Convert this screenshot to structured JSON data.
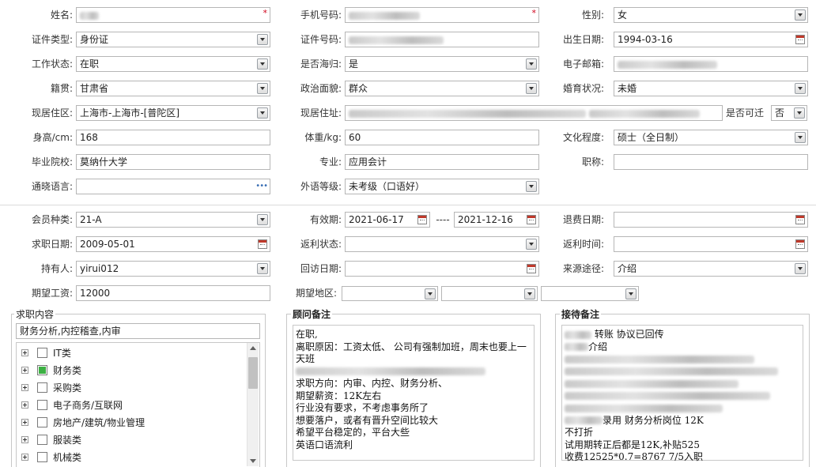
{
  "profile": {
    "name_label": "姓名:",
    "phone_label": "手机号码:",
    "gender_label": "性别:",
    "gender_value": "女",
    "idtype_label": "证件类型:",
    "idtype_value": "身份证",
    "idno_label": "证件号码:",
    "birth_label": "出生日期:",
    "birth_value": "1994-03-16",
    "work_label": "工作状态:",
    "work_value": "在职",
    "overseas_label": "是否海归:",
    "overseas_value": "是",
    "email_label": "电子邮箱:",
    "native_label": "籍贯:",
    "native_value": "甘肃省",
    "political_label": "政治面貌:",
    "political_value": "群众",
    "marital_label": "婚育状况:",
    "marital_value": "未婚",
    "residence_area_label": "现居住区:",
    "residence_area_value": "上海市-上海市-[普陀区]",
    "address_label": "现居住址:",
    "relocate_label": "是否可迁",
    "relocate_value": "否",
    "height_label": "身高/cm:",
    "height_value": "168",
    "weight_label": "体重/kg:",
    "weight_value": "60",
    "edu_label": "文化程度:",
    "edu_value": "硕士（全日制）",
    "school_label": "毕业院校:",
    "school_value": "莫纳什大学",
    "major_label": "专业:",
    "major_value": "应用会计",
    "title_label": "职称:",
    "lang_label": "通晓语言:",
    "lang_more": "•••",
    "foreign_label": "外语等级:",
    "foreign_value": "未考级（口语好）"
  },
  "membership": {
    "type_label": "会员种类:",
    "type_value": "21-A",
    "valid_label": "有效期:",
    "valid_from": "2021-06-17",
    "valid_dash": "----",
    "valid_to": "2021-12-16",
    "refund_date_label": "退费日期:",
    "job_date_label": "求职日期:",
    "job_date_value": "2009-05-01",
    "rebate_status_label": "返利状态:",
    "rebate_time_label": "返利时间:",
    "holder_label": "持有人:",
    "holder_value": "yirui012",
    "visit_date_label": "回访日期:",
    "source_label": "来源途径:",
    "source_value": "介绍",
    "salary_label": "期望工资:",
    "salary_value": "12000",
    "region_label": "期望地区:"
  },
  "job_content": {
    "title": "求职内容",
    "summary": "财务分析,内控稽查,内审",
    "items": [
      {
        "label": "IT类",
        "checked": false
      },
      {
        "label": "财务类",
        "checked": true
      },
      {
        "label": "采购类",
        "checked": false
      },
      {
        "label": "电子商务/互联网",
        "checked": false
      },
      {
        "label": "房地产/建筑/物业管理",
        "checked": false
      },
      {
        "label": "服装类",
        "checked": false
      },
      {
        "label": "机械类",
        "checked": false
      }
    ]
  },
  "advisor_notes": {
    "title": "顾问备注",
    "lines": [
      "在职,",
      "离职原因：工资太低、 公司有强制加班，周末也要上一",
      "天班",
      "",
      "求职方向：内审、内控、财务分析、",
      "期望薪资：12K左右",
      "行业没有要求，不考虑事务所了",
      "想要落户，或者有晋升空间比较大",
      "希望平台稳定的，平台大些",
      "英语口语流利"
    ]
  },
  "reception_notes": {
    "title": "接待备注",
    "line1": "转账 协议已回传",
    "line2": "介绍",
    "line3": "录用 财务分析岗位  12K",
    "line4": "不打折",
    "line5": "试用期转正后都是12K,补贴525",
    "line6": "收费12525*0.7=8767   7/5入职"
  }
}
